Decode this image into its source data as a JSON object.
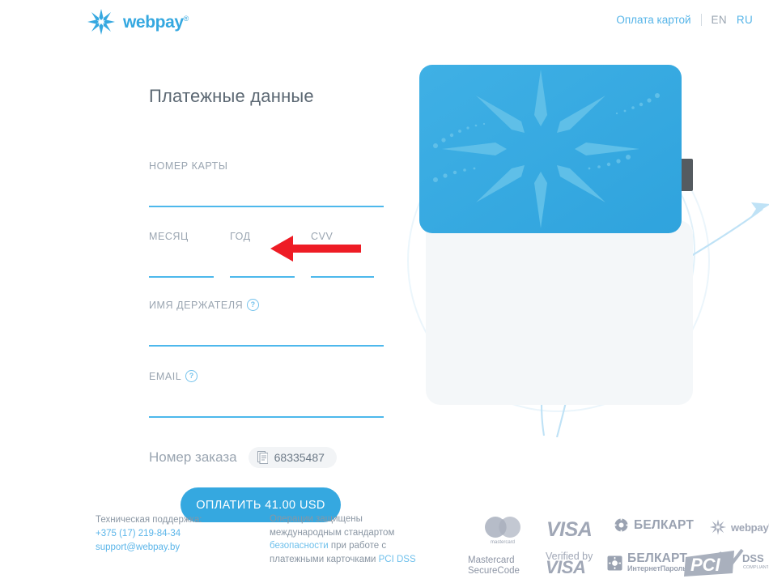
{
  "header": {
    "logo_text": "webpay",
    "logo_reg": "®",
    "nav_link": "Оплата картой",
    "lang_en": "EN",
    "lang_ru": "RU"
  },
  "form": {
    "title": "Платежные данные",
    "card_number": {
      "label": "НОМЕР КАРТЫ",
      "value": "",
      "placeholder": ""
    },
    "month": {
      "label": "МЕСЯЦ",
      "value": "",
      "placeholder": ""
    },
    "year": {
      "label": "ГОД",
      "value": "",
      "placeholder": ""
    },
    "cvv": {
      "label": "CVV",
      "value": "",
      "placeholder": ""
    },
    "holder": {
      "label": "ИМЯ ДЕРЖАТЕЛЯ",
      "value": "",
      "placeholder": "",
      "help": "?"
    },
    "email": {
      "label": "EMAIL",
      "value": "",
      "placeholder": "",
      "help": "?"
    },
    "order_label": "Номер заказа",
    "order_number": "68335487",
    "pay_button": "ОПЛАТИТЬ 41.00 USD"
  },
  "footer": {
    "support_title": "Техническая поддержка:",
    "support_phone": "+375 (17) 219-84-34",
    "support_email": "support@webpay.by",
    "secure_line1": "Операции защищены",
    "secure_line2": "международным стандартом",
    "secure_link1": "безопасности",
    "secure_line3": " при работе с",
    "secure_line4": "платежными карточками ",
    "secure_link2": "PCI DSS",
    "logos": {
      "mastercard_word": "mastercard",
      "mastercard_secure_1": "Mastercard",
      "mastercard_secure_2": "SecureCode",
      "visa": "VISA",
      "verified_by": "Verified by",
      "verified_visa": "VISA",
      "belkart": "БЕЛКАРТ",
      "belkart_internet": "БЕЛКАРТ",
      "belkart_internet_sub": "ИнтернетПароль",
      "webpay": "webpay",
      "webpay_reg": "®",
      "pci": "PCI",
      "pci_dss": "DSS",
      "pci_compliant": "COMPLIANT"
    }
  },
  "colors": {
    "accent": "#35a8e0",
    "accent_light": "#4db8ec",
    "card_blue": "#35a8e0",
    "arrow_red": "#ee1c25",
    "label_grey": "#9aa5b1"
  },
  "annotation": {
    "arrow": "red-left-arrow pointing at year/cvv fields"
  }
}
